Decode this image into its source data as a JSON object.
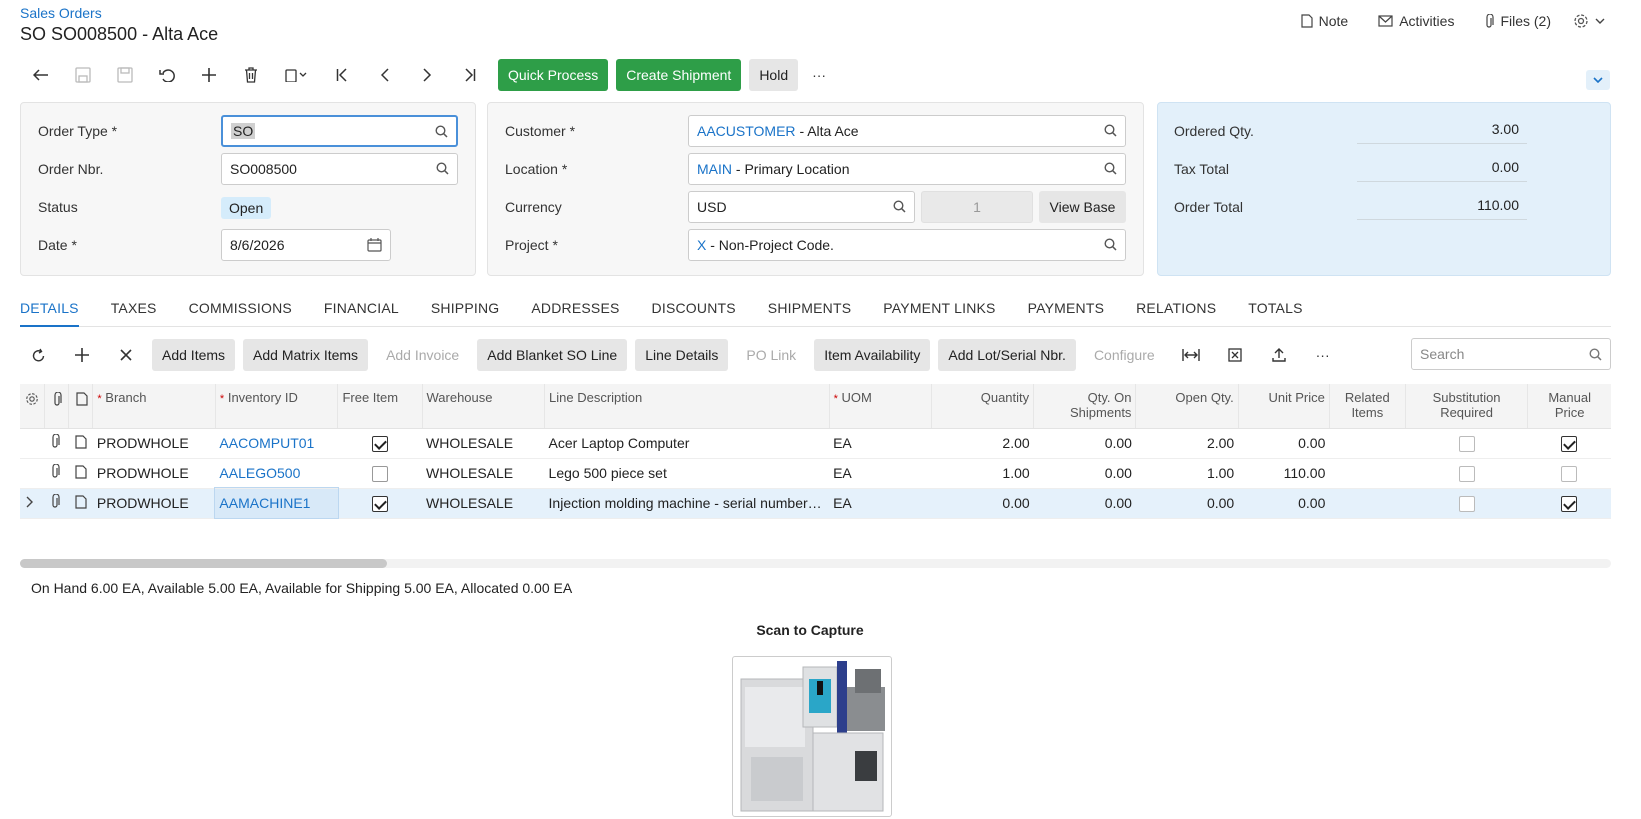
{
  "header": {
    "breadcrumb": "Sales Orders",
    "title": "SO SO008500 - Alta Ace",
    "note": "Note",
    "activities": "Activities",
    "files": "Files (2)"
  },
  "toolbar": {
    "quick_process": "Quick Process",
    "create_shipment": "Create Shipment",
    "hold": "Hold",
    "more": "···"
  },
  "form": {
    "order_type_label": "Order Type",
    "order_type_value": "SO",
    "order_nbr_label": "Order Nbr.",
    "order_nbr_value": "SO008500",
    "status_label": "Status",
    "status_value": "Open",
    "date_label": "Date",
    "date_value": "8/6/2026",
    "customer_label": "Customer",
    "customer_id": "AACUSTOMER",
    "customer_name": "- Alta Ace",
    "location_label": "Location",
    "location_id": "MAIN",
    "location_name": "- Primary Location",
    "currency_label": "Currency",
    "currency_value": "USD",
    "currency_rate": "1",
    "view_base": "View Base",
    "project_label": "Project",
    "project_id": "X",
    "project_name": "- Non-Project Code.",
    "req_mark": "*"
  },
  "summary": {
    "ordered_qty_label": "Ordered Qty.",
    "ordered_qty_value": "3.00",
    "tax_total_label": "Tax Total",
    "tax_total_value": "0.00",
    "order_total_label": "Order Total",
    "order_total_value": "110.00"
  },
  "tabs": [
    "DETAILS",
    "TAXES",
    "COMMISSIONS",
    "FINANCIAL",
    "SHIPPING",
    "ADDRESSES",
    "DISCOUNTS",
    "SHIPMENTS",
    "PAYMENT LINKS",
    "PAYMENTS",
    "RELATIONS",
    "TOTALS"
  ],
  "grid_toolbar": {
    "add_items": "Add Items",
    "add_matrix_items": "Add Matrix Items",
    "add_invoice": "Add Invoice",
    "add_blanket": "Add Blanket SO Line",
    "line_details": "Line Details",
    "po_link": "PO Link",
    "item_availability": "Item Availability",
    "add_lot": "Add Lot/Serial Nbr.",
    "configure": "Configure",
    "more": "···",
    "search_placeholder": "Search"
  },
  "columns": {
    "branch": "Branch",
    "inventory_id": "Inventory ID",
    "free_item": "Free Item",
    "warehouse": "Warehouse",
    "line_description": "Line Description",
    "uom": "UOM",
    "quantity": "Quantity",
    "qty_on_shipments": "Qty. On Shipments",
    "open_qty": "Open Qty.",
    "unit_price": "Unit Price",
    "related_items": "Related Items",
    "substitution_required": "Substitution Required",
    "manual_price": "Manual Price"
  },
  "rows": [
    {
      "branch": "PRODWHOLE",
      "inventory_id": "AACOMPUT01",
      "warehouse": "WHOLESALE",
      "description": "Acer Laptop Computer",
      "uom": "EA",
      "quantity": "2.00",
      "qty_on_shipments": "0.00",
      "open_qty": "2.00",
      "unit_price": "0.00"
    },
    {
      "branch": "PRODWHOLE",
      "inventory_id": "AALEGO500",
      "warehouse": "WHOLESALE",
      "description": "Lego 500 piece set",
      "uom": "EA",
      "quantity": "1.00",
      "qty_on_shipments": "0.00",
      "open_qty": "1.00",
      "unit_price": "110.00"
    },
    {
      "branch": "PRODWHOLE",
      "inventory_id": "AAMACHINE1",
      "warehouse": "WHOLESALE",
      "description": "Injection molding machine - serial number tracked",
      "uom": "EA",
      "quantity": "0.00",
      "qty_on_shipments": "0.00",
      "open_qty": "0.00",
      "unit_price": "0.00"
    }
  ],
  "footer": {
    "availability": "On Hand 6.00 EA, Available 5.00 EA, Available for Shipping 5.00 EA, Allocated 0.00 EA",
    "scan_title": "Scan to Capture"
  },
  "colors": {
    "accent": "#1a73c8",
    "green": "#2e9e48",
    "summary_bg": "#e3f0fa"
  }
}
